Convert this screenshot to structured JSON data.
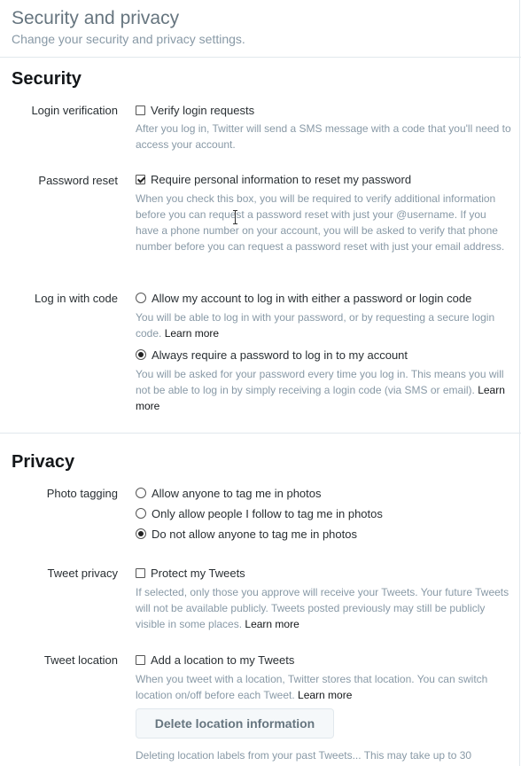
{
  "header": {
    "title": "Security and privacy",
    "subtitle": "Change your security and privacy settings."
  },
  "security": {
    "title": "Security",
    "login_verification": {
      "label": "Login verification",
      "option": "Verify login requests",
      "checked": false,
      "help": "After you log in, Twitter will send a SMS message with a code that you'll need to access your account."
    },
    "password_reset": {
      "label": "Password reset",
      "option": "Require personal information to reset my password",
      "checked": true,
      "help": "When you check this box, you will be required to verify additional information before you can request a password reset with just your @username. If you have a phone number on your account, you will be asked to verify that phone number before you can request a password reset with just your email address."
    },
    "login_with_code": {
      "label": "Log in with code",
      "option1": "Allow my account to log in with either a password or login code",
      "help1": "You will be able to log in with your password, or by requesting a secure login code.",
      "learn_more1": "Learn more",
      "option2": "Always require a password to log in to my account",
      "help2": "You will be asked for your password every time you log in. This means you will not be able to log in by simply receiving a login code (via SMS or email).",
      "learn_more2": "Learn more",
      "selected": 2
    }
  },
  "privacy": {
    "title": "Privacy",
    "photo_tagging": {
      "label": "Photo tagging",
      "options": [
        "Allow anyone to tag me in photos",
        "Only allow people I follow to tag me in photos",
        "Do not allow anyone to tag me in photos"
      ],
      "selected": 2
    },
    "tweet_privacy": {
      "label": "Tweet privacy",
      "option": "Protect my Tweets",
      "checked": false,
      "help": "If selected, only those you approve will receive your Tweets. Your future Tweets will not be available publicly. Tweets posted previously may still be publicly visible in some places.",
      "learn_more": "Learn more"
    },
    "tweet_location": {
      "label": "Tweet location",
      "option": "Add a location to my Tweets",
      "checked": false,
      "help": "When you tweet with a location, Twitter stores that location. You can switch location on/off before each Tweet.",
      "learn_more": "Learn more",
      "button": "Delete location information",
      "footer": "Deleting location labels from your past Tweets... This may take up to 30"
    }
  }
}
